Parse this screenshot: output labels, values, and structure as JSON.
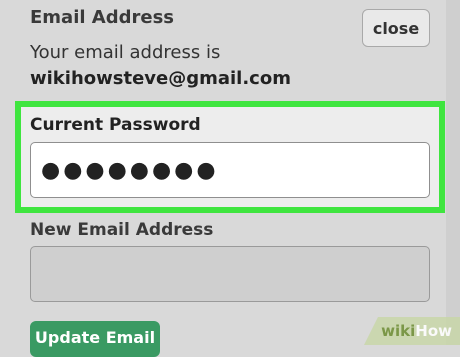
{
  "section": {
    "title": "Email Address",
    "close_label": "close"
  },
  "info": {
    "line1": "Your email address is",
    "email": "wikihowsteve@gmail.com"
  },
  "current_password": {
    "label": "Current Password",
    "masked_value": "●●●●●●●●"
  },
  "new_email": {
    "label": "New Email Address",
    "value": ""
  },
  "actions": {
    "update_label": "Update Email"
  },
  "watermark": {
    "wiki": "wiki",
    "how": "How"
  },
  "colors": {
    "highlight": "#3fe53f",
    "update_button": "#3a9a63",
    "background": "#d9d9d9"
  }
}
